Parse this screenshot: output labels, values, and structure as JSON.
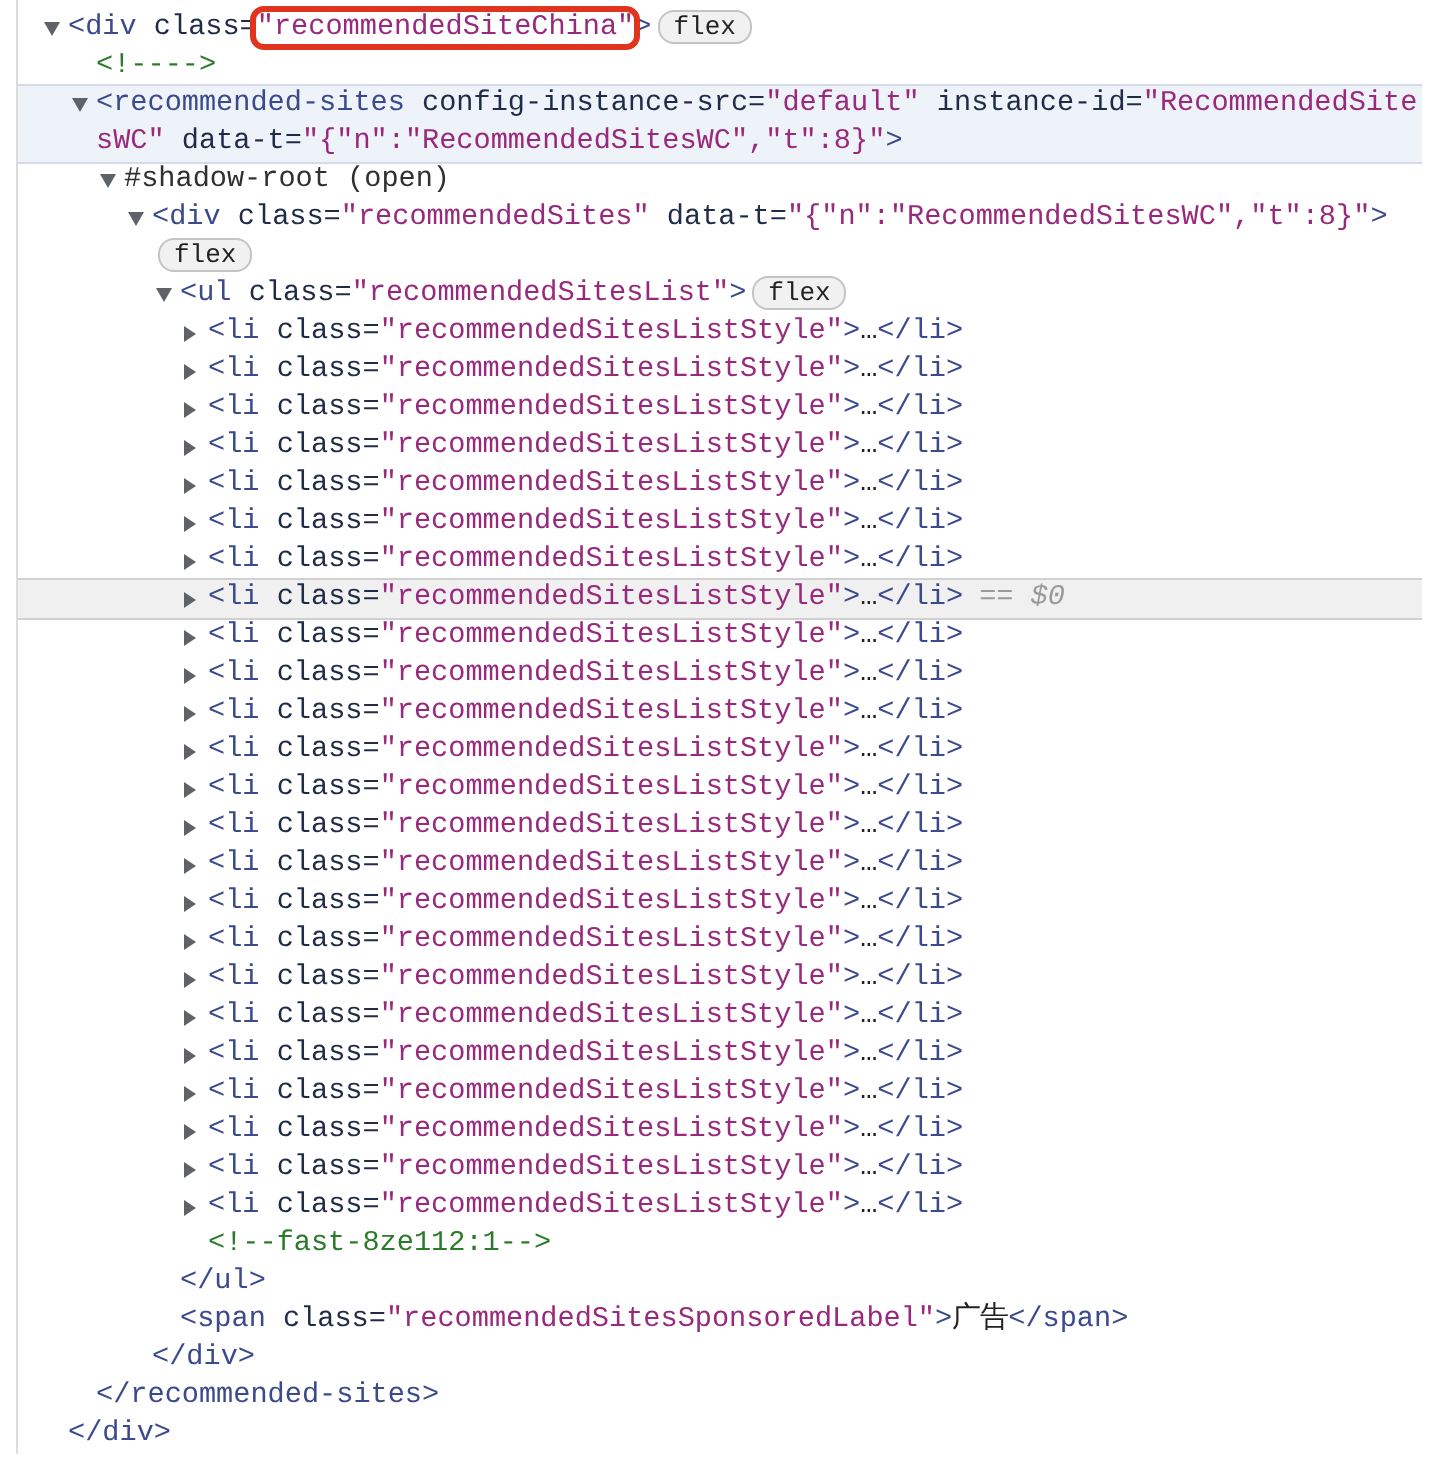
{
  "tree": [
    {
      "kind": "element",
      "expanded": true,
      "selected": false,
      "highlighted": false,
      "tokens": [
        {
          "kind": "tag",
          "text": "<div"
        },
        {
          "kind": "attr",
          "text": " class="
        },
        {
          "kind": "value",
          "text": "\"recommendedSiteChina\"",
          "annotated": true
        },
        {
          "kind": "tag",
          "text": ">"
        }
      ],
      "badges": [
        "flex"
      ],
      "closing": [
        {
          "kind": "tag",
          "text": "</div>"
        }
      ],
      "children": [
        {
          "kind": "text",
          "selected": false,
          "highlighted": false,
          "tokens": [
            {
              "kind": "comment",
              "text": "<!---->"
            }
          ]
        },
        {
          "kind": "element",
          "expanded": true,
          "selected": false,
          "highlighted": true,
          "tokens": [
            {
              "kind": "tag",
              "text": "<recommended-sites"
            },
            {
              "kind": "attr",
              "text": " config-instance-src="
            },
            {
              "kind": "value",
              "text": "\"default\""
            },
            {
              "kind": "attr",
              "text": " instance-id="
            },
            {
              "kind": "value",
              "text": "\"RecommendedSitesWC\""
            },
            {
              "kind": "attr",
              "text": " data-t="
            },
            {
              "kind": "value",
              "text": "\"{\"n\":\"RecommendedSitesWC\",\"t\":8}\""
            },
            {
              "kind": "tag",
              "text": ">"
            }
          ],
          "closing": [
            {
              "kind": "tag",
              "text": "</recommended-sites>"
            }
          ],
          "children": [
            {
              "kind": "element",
              "expanded": true,
              "selected": false,
              "highlighted": false,
              "tokens": [
                {
                  "kind": "plain",
                  "text": "#shadow-root (open)"
                }
              ],
              "children": [
                {
                  "kind": "element",
                  "expanded": true,
                  "selected": false,
                  "highlighted": false,
                  "tokens": [
                    {
                      "kind": "tag",
                      "text": "<div"
                    },
                    {
                      "kind": "attr",
                      "text": " class="
                    },
                    {
                      "kind": "value",
                      "text": "\"recommendedSites\""
                    },
                    {
                      "kind": "attr",
                      "text": " data-t="
                    },
                    {
                      "kind": "value",
                      "text": "\"{\"n\":\"RecommendedSitesWC\",\"t\":8}\""
                    },
                    {
                      "kind": "tag",
                      "text": ">"
                    }
                  ],
                  "badges": [
                    "flex"
                  ],
                  "closing": [
                    {
                      "kind": "tag",
                      "text": "</div>"
                    }
                  ],
                  "children": [
                    {
                      "kind": "element",
                      "expanded": true,
                      "selected": false,
                      "highlighted": false,
                      "tokens": [
                        {
                          "kind": "tag",
                          "text": "<ul"
                        },
                        {
                          "kind": "attr",
                          "text": " class="
                        },
                        {
                          "kind": "value",
                          "text": "\"recommendedSitesList\""
                        },
                        {
                          "kind": "tag",
                          "text": ">"
                        }
                      ],
                      "badges": [
                        "flex"
                      ],
                      "closing": [
                        {
                          "kind": "tag",
                          "text": "</ul>"
                        }
                      ],
                      "children": [
                        {
                          "kind": "element",
                          "expanded": false,
                          "selected": false,
                          "highlighted": false,
                          "tokens": [
                            {
                              "kind": "tag",
                              "text": "<li"
                            },
                            {
                              "kind": "attr",
                              "text": " class="
                            },
                            {
                              "kind": "value",
                              "text": "\"recommendedSitesListStyle\""
                            },
                            {
                              "kind": "tag",
                              "text": ">"
                            },
                            {
                              "kind": "text",
                              "text": "…"
                            },
                            {
                              "kind": "tag",
                              "text": "</li>"
                            }
                          ]
                        },
                        {
                          "kind": "element",
                          "expanded": false,
                          "selected": false,
                          "highlighted": false,
                          "tokens": [
                            {
                              "kind": "tag",
                              "text": "<li"
                            },
                            {
                              "kind": "attr",
                              "text": " class="
                            },
                            {
                              "kind": "value",
                              "text": "\"recommendedSitesListStyle\""
                            },
                            {
                              "kind": "tag",
                              "text": ">"
                            },
                            {
                              "kind": "text",
                              "text": "…"
                            },
                            {
                              "kind": "tag",
                              "text": "</li>"
                            }
                          ]
                        },
                        {
                          "kind": "element",
                          "expanded": false,
                          "selected": false,
                          "highlighted": false,
                          "tokens": [
                            {
                              "kind": "tag",
                              "text": "<li"
                            },
                            {
                              "kind": "attr",
                              "text": " class="
                            },
                            {
                              "kind": "value",
                              "text": "\"recommendedSitesListStyle\""
                            },
                            {
                              "kind": "tag",
                              "text": ">"
                            },
                            {
                              "kind": "text",
                              "text": "…"
                            },
                            {
                              "kind": "tag",
                              "text": "</li>"
                            }
                          ]
                        },
                        {
                          "kind": "element",
                          "expanded": false,
                          "selected": false,
                          "highlighted": false,
                          "tokens": [
                            {
                              "kind": "tag",
                              "text": "<li"
                            },
                            {
                              "kind": "attr",
                              "text": " class="
                            },
                            {
                              "kind": "value",
                              "text": "\"recommendedSitesListStyle\""
                            },
                            {
                              "kind": "tag",
                              "text": ">"
                            },
                            {
                              "kind": "text",
                              "text": "…"
                            },
                            {
                              "kind": "tag",
                              "text": "</li>"
                            }
                          ]
                        },
                        {
                          "kind": "element",
                          "expanded": false,
                          "selected": false,
                          "highlighted": false,
                          "tokens": [
                            {
                              "kind": "tag",
                              "text": "<li"
                            },
                            {
                              "kind": "attr",
                              "text": " class="
                            },
                            {
                              "kind": "value",
                              "text": "\"recommendedSitesListStyle\""
                            },
                            {
                              "kind": "tag",
                              "text": ">"
                            },
                            {
                              "kind": "text",
                              "text": "…"
                            },
                            {
                              "kind": "tag",
                              "text": "</li>"
                            }
                          ]
                        },
                        {
                          "kind": "element",
                          "expanded": false,
                          "selected": false,
                          "highlighted": false,
                          "tokens": [
                            {
                              "kind": "tag",
                              "text": "<li"
                            },
                            {
                              "kind": "attr",
                              "text": " class="
                            },
                            {
                              "kind": "value",
                              "text": "\"recommendedSitesListStyle\""
                            },
                            {
                              "kind": "tag",
                              "text": ">"
                            },
                            {
                              "kind": "text",
                              "text": "…"
                            },
                            {
                              "kind": "tag",
                              "text": "</li>"
                            }
                          ]
                        },
                        {
                          "kind": "element",
                          "expanded": false,
                          "selected": false,
                          "highlighted": false,
                          "tokens": [
                            {
                              "kind": "tag",
                              "text": "<li"
                            },
                            {
                              "kind": "attr",
                              "text": " class="
                            },
                            {
                              "kind": "value",
                              "text": "\"recommendedSitesListStyle\""
                            },
                            {
                              "kind": "tag",
                              "text": ">"
                            },
                            {
                              "kind": "text",
                              "text": "…"
                            },
                            {
                              "kind": "tag",
                              "text": "</li>"
                            }
                          ]
                        },
                        {
                          "kind": "element",
                          "expanded": false,
                          "selected": true,
                          "highlighted": false,
                          "tokens": [
                            {
                              "kind": "tag",
                              "text": "<li"
                            },
                            {
                              "kind": "attr",
                              "text": " class="
                            },
                            {
                              "kind": "value",
                              "text": "\"recommendedSitesListStyle\""
                            },
                            {
                              "kind": "tag",
                              "text": ">"
                            },
                            {
                              "kind": "text",
                              "text": "…"
                            },
                            {
                              "kind": "tag",
                              "text": "</li>"
                            }
                          ],
                          "marker": "== $0"
                        },
                        {
                          "kind": "element",
                          "expanded": false,
                          "selected": false,
                          "highlighted": false,
                          "tokens": [
                            {
                              "kind": "tag",
                              "text": "<li"
                            },
                            {
                              "kind": "attr",
                              "text": " class="
                            },
                            {
                              "kind": "value",
                              "text": "\"recommendedSitesListStyle\""
                            },
                            {
                              "kind": "tag",
                              "text": ">"
                            },
                            {
                              "kind": "text",
                              "text": "…"
                            },
                            {
                              "kind": "tag",
                              "text": "</li>"
                            }
                          ]
                        },
                        {
                          "kind": "element",
                          "expanded": false,
                          "selected": false,
                          "highlighted": false,
                          "tokens": [
                            {
                              "kind": "tag",
                              "text": "<li"
                            },
                            {
                              "kind": "attr",
                              "text": " class="
                            },
                            {
                              "kind": "value",
                              "text": "\"recommendedSitesListStyle\""
                            },
                            {
                              "kind": "tag",
                              "text": ">"
                            },
                            {
                              "kind": "text",
                              "text": "…"
                            },
                            {
                              "kind": "tag",
                              "text": "</li>"
                            }
                          ]
                        },
                        {
                          "kind": "element",
                          "expanded": false,
                          "selected": false,
                          "highlighted": false,
                          "tokens": [
                            {
                              "kind": "tag",
                              "text": "<li"
                            },
                            {
                              "kind": "attr",
                              "text": " class="
                            },
                            {
                              "kind": "value",
                              "text": "\"recommendedSitesListStyle\""
                            },
                            {
                              "kind": "tag",
                              "text": ">"
                            },
                            {
                              "kind": "text",
                              "text": "…"
                            },
                            {
                              "kind": "tag",
                              "text": "</li>"
                            }
                          ]
                        },
                        {
                          "kind": "element",
                          "expanded": false,
                          "selected": false,
                          "highlighted": false,
                          "tokens": [
                            {
                              "kind": "tag",
                              "text": "<li"
                            },
                            {
                              "kind": "attr",
                              "text": " class="
                            },
                            {
                              "kind": "value",
                              "text": "\"recommendedSitesListStyle\""
                            },
                            {
                              "kind": "tag",
                              "text": ">"
                            },
                            {
                              "kind": "text",
                              "text": "…"
                            },
                            {
                              "kind": "tag",
                              "text": "</li>"
                            }
                          ]
                        },
                        {
                          "kind": "element",
                          "expanded": false,
                          "selected": false,
                          "highlighted": false,
                          "tokens": [
                            {
                              "kind": "tag",
                              "text": "<li"
                            },
                            {
                              "kind": "attr",
                              "text": " class="
                            },
                            {
                              "kind": "value",
                              "text": "\"recommendedSitesListStyle\""
                            },
                            {
                              "kind": "tag",
                              "text": ">"
                            },
                            {
                              "kind": "text",
                              "text": "…"
                            },
                            {
                              "kind": "tag",
                              "text": "</li>"
                            }
                          ]
                        },
                        {
                          "kind": "element",
                          "expanded": false,
                          "selected": false,
                          "highlighted": false,
                          "tokens": [
                            {
                              "kind": "tag",
                              "text": "<li"
                            },
                            {
                              "kind": "attr",
                              "text": " class="
                            },
                            {
                              "kind": "value",
                              "text": "\"recommendedSitesListStyle\""
                            },
                            {
                              "kind": "tag",
                              "text": ">"
                            },
                            {
                              "kind": "text",
                              "text": "…"
                            },
                            {
                              "kind": "tag",
                              "text": "</li>"
                            }
                          ]
                        },
                        {
                          "kind": "element",
                          "expanded": false,
                          "selected": false,
                          "highlighted": false,
                          "tokens": [
                            {
                              "kind": "tag",
                              "text": "<li"
                            },
                            {
                              "kind": "attr",
                              "text": " class="
                            },
                            {
                              "kind": "value",
                              "text": "\"recommendedSitesListStyle\""
                            },
                            {
                              "kind": "tag",
                              "text": ">"
                            },
                            {
                              "kind": "text",
                              "text": "…"
                            },
                            {
                              "kind": "tag",
                              "text": "</li>"
                            }
                          ]
                        },
                        {
                          "kind": "element",
                          "expanded": false,
                          "selected": false,
                          "highlighted": false,
                          "tokens": [
                            {
                              "kind": "tag",
                              "text": "<li"
                            },
                            {
                              "kind": "attr",
                              "text": " class="
                            },
                            {
                              "kind": "value",
                              "text": "\"recommendedSitesListStyle\""
                            },
                            {
                              "kind": "tag",
                              "text": ">"
                            },
                            {
                              "kind": "text",
                              "text": "…"
                            },
                            {
                              "kind": "tag",
                              "text": "</li>"
                            }
                          ]
                        },
                        {
                          "kind": "element",
                          "expanded": false,
                          "selected": false,
                          "highlighted": false,
                          "tokens": [
                            {
                              "kind": "tag",
                              "text": "<li"
                            },
                            {
                              "kind": "attr",
                              "text": " class="
                            },
                            {
                              "kind": "value",
                              "text": "\"recommendedSitesListStyle\""
                            },
                            {
                              "kind": "tag",
                              "text": ">"
                            },
                            {
                              "kind": "text",
                              "text": "…"
                            },
                            {
                              "kind": "tag",
                              "text": "</li>"
                            }
                          ]
                        },
                        {
                          "kind": "element",
                          "expanded": false,
                          "selected": false,
                          "highlighted": false,
                          "tokens": [
                            {
                              "kind": "tag",
                              "text": "<li"
                            },
                            {
                              "kind": "attr",
                              "text": " class="
                            },
                            {
                              "kind": "value",
                              "text": "\"recommendedSitesListStyle\""
                            },
                            {
                              "kind": "tag",
                              "text": ">"
                            },
                            {
                              "kind": "text",
                              "text": "…"
                            },
                            {
                              "kind": "tag",
                              "text": "</li>"
                            }
                          ]
                        },
                        {
                          "kind": "element",
                          "expanded": false,
                          "selected": false,
                          "highlighted": false,
                          "tokens": [
                            {
                              "kind": "tag",
                              "text": "<li"
                            },
                            {
                              "kind": "attr",
                              "text": " class="
                            },
                            {
                              "kind": "value",
                              "text": "\"recommendedSitesListStyle\""
                            },
                            {
                              "kind": "tag",
                              "text": ">"
                            },
                            {
                              "kind": "text",
                              "text": "…"
                            },
                            {
                              "kind": "tag",
                              "text": "</li>"
                            }
                          ]
                        },
                        {
                          "kind": "element",
                          "expanded": false,
                          "selected": false,
                          "highlighted": false,
                          "tokens": [
                            {
                              "kind": "tag",
                              "text": "<li"
                            },
                            {
                              "kind": "attr",
                              "text": " class="
                            },
                            {
                              "kind": "value",
                              "text": "\"recommendedSitesListStyle\""
                            },
                            {
                              "kind": "tag",
                              "text": ">"
                            },
                            {
                              "kind": "text",
                              "text": "…"
                            },
                            {
                              "kind": "tag",
                              "text": "</li>"
                            }
                          ]
                        },
                        {
                          "kind": "element",
                          "expanded": false,
                          "selected": false,
                          "highlighted": false,
                          "tokens": [
                            {
                              "kind": "tag",
                              "text": "<li"
                            },
                            {
                              "kind": "attr",
                              "text": " class="
                            },
                            {
                              "kind": "value",
                              "text": "\"recommendedSitesListStyle\""
                            },
                            {
                              "kind": "tag",
                              "text": ">"
                            },
                            {
                              "kind": "text",
                              "text": "…"
                            },
                            {
                              "kind": "tag",
                              "text": "</li>"
                            }
                          ]
                        },
                        {
                          "kind": "element",
                          "expanded": false,
                          "selected": false,
                          "highlighted": false,
                          "tokens": [
                            {
                              "kind": "tag",
                              "text": "<li"
                            },
                            {
                              "kind": "attr",
                              "text": " class="
                            },
                            {
                              "kind": "value",
                              "text": "\"recommendedSitesListStyle\""
                            },
                            {
                              "kind": "tag",
                              "text": ">"
                            },
                            {
                              "kind": "text",
                              "text": "…"
                            },
                            {
                              "kind": "tag",
                              "text": "</li>"
                            }
                          ]
                        },
                        {
                          "kind": "element",
                          "expanded": false,
                          "selected": false,
                          "highlighted": false,
                          "tokens": [
                            {
                              "kind": "tag",
                              "text": "<li"
                            },
                            {
                              "kind": "attr",
                              "text": " class="
                            },
                            {
                              "kind": "value",
                              "text": "\"recommendedSitesListStyle\""
                            },
                            {
                              "kind": "tag",
                              "text": ">"
                            },
                            {
                              "kind": "text",
                              "text": "…"
                            },
                            {
                              "kind": "tag",
                              "text": "</li>"
                            }
                          ]
                        },
                        {
                          "kind": "element",
                          "expanded": false,
                          "selected": false,
                          "highlighted": false,
                          "tokens": [
                            {
                              "kind": "tag",
                              "text": "<li"
                            },
                            {
                              "kind": "attr",
                              "text": " class="
                            },
                            {
                              "kind": "value",
                              "text": "\"recommendedSitesListStyle\""
                            },
                            {
                              "kind": "tag",
                              "text": ">"
                            },
                            {
                              "kind": "text",
                              "text": "…"
                            },
                            {
                              "kind": "tag",
                              "text": "</li>"
                            }
                          ]
                        },
                        {
                          "kind": "text",
                          "selected": false,
                          "highlighted": false,
                          "tokens": [
                            {
                              "kind": "comment",
                              "text": "<!--fast-8ze112:1-->"
                            }
                          ]
                        }
                      ]
                    },
                    {
                      "kind": "text",
                      "selected": false,
                      "highlighted": false,
                      "tokens": [
                        {
                          "kind": "tag",
                          "text": "<span"
                        },
                        {
                          "kind": "attr",
                          "text": " class="
                        },
                        {
                          "kind": "value",
                          "text": "\"recommendedSitesSponsoredLabel\""
                        },
                        {
                          "kind": "tag",
                          "text": ">"
                        },
                        {
                          "kind": "text",
                          "text": "广告"
                        },
                        {
                          "kind": "tag",
                          "text": "</span>"
                        }
                      ]
                    }
                  ]
                }
              ]
            }
          ]
        }
      ]
    }
  ]
}
